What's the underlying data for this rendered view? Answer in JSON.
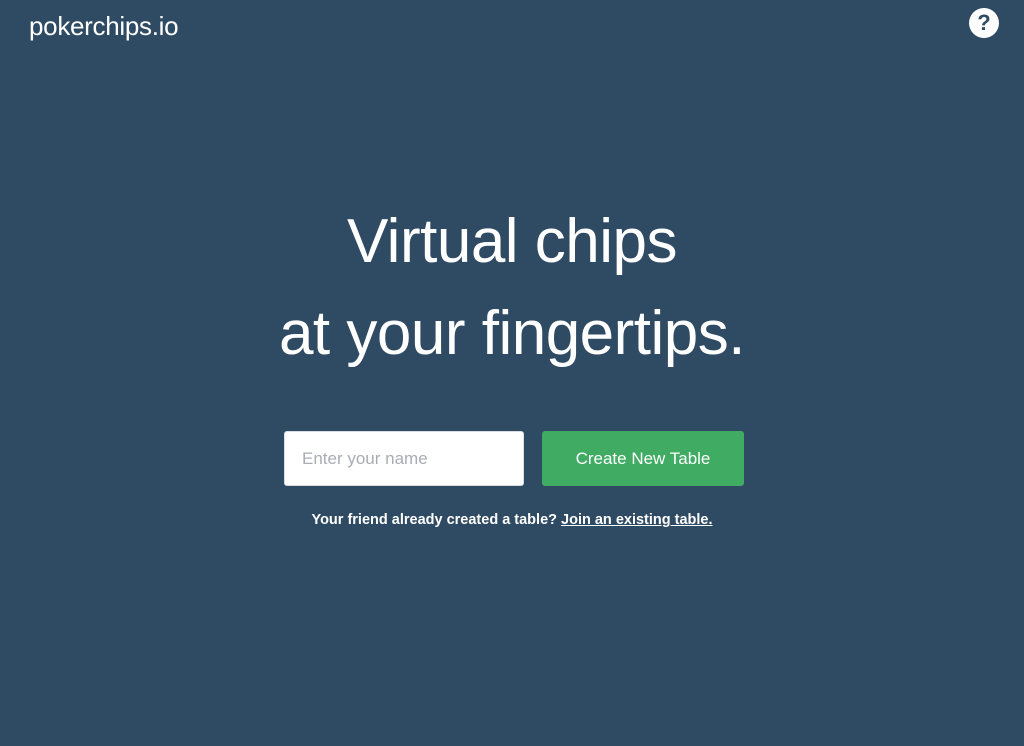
{
  "header": {
    "logo_text": "pokerchips.io",
    "help_icon": "question-circle-icon",
    "help_glyph": "?"
  },
  "hero": {
    "line1": "Virtual chips",
    "line2": "at your fingertips."
  },
  "form": {
    "name_placeholder": "Enter your name",
    "name_value": "",
    "create_button_label": "Create New Table"
  },
  "join": {
    "prompt_text": "Your friend already created a table?",
    "link_text": "Join an existing table."
  },
  "colors": {
    "background": "#2f4a63",
    "accent_green": "#3fab63",
    "text": "#ffffff"
  }
}
